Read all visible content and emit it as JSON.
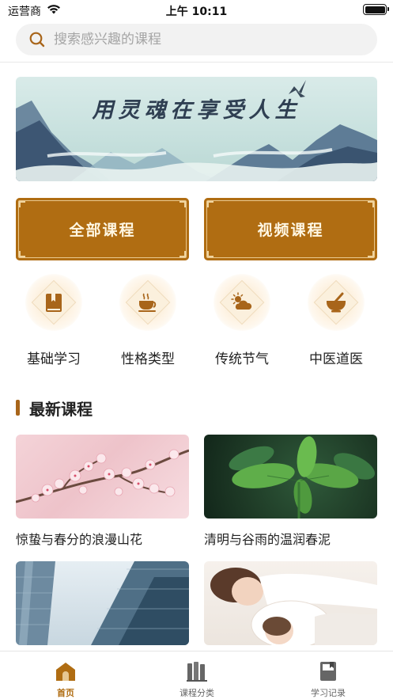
{
  "status_bar": {
    "carrier": "运营商",
    "time": "上午 10:11"
  },
  "search": {
    "placeholder": "搜索感兴趣的课程"
  },
  "banner": {
    "text": "用灵魂在享受人生"
  },
  "buttons": {
    "all_courses": "全部课程",
    "video_courses": "视频课程"
  },
  "categories": [
    {
      "label": "基础学习",
      "icon": "book-icon"
    },
    {
      "label": "性格类型",
      "icon": "coffee-cup-icon"
    },
    {
      "label": "传统节气",
      "icon": "sun-cloud-icon"
    },
    {
      "label": "中医道医",
      "icon": "mortar-pestle-icon"
    }
  ],
  "latest": {
    "title": "最新课程",
    "courses": [
      {
        "title": "惊蛰与春分的浪漫山花"
      },
      {
        "title": "清明与谷雨的温润春泥"
      },
      {
        "title": ""
      },
      {
        "title": ""
      }
    ]
  },
  "tabbar": {
    "items": [
      {
        "label": "首页",
        "icon": "home-icon",
        "active": true
      },
      {
        "label": "课程分类",
        "icon": "books-icon",
        "active": false
      },
      {
        "label": "学习记录",
        "icon": "notebook-icon",
        "active": false
      }
    ]
  },
  "colors": {
    "accent": "#b06d12",
    "accent_light": "#fbf0dd"
  }
}
